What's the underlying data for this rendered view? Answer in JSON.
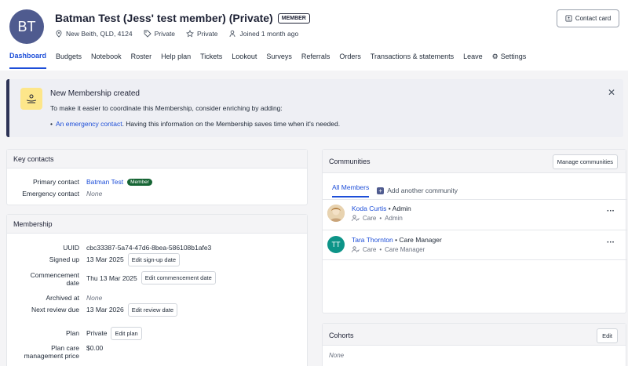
{
  "header": {
    "initials": "BT",
    "title": "Batman Test (Jess' test member) (Private)",
    "badge": "MEMBER",
    "location": "New Beith, QLD, 4124",
    "privacy1": "Private",
    "privacy2": "Private",
    "joined": "Joined 1 month ago",
    "contact_card": "Contact card"
  },
  "tabs": [
    {
      "label": "Dashboard"
    },
    {
      "label": "Budgets"
    },
    {
      "label": "Notebook"
    },
    {
      "label": "Roster"
    },
    {
      "label": "Help plan"
    },
    {
      "label": "Tickets"
    },
    {
      "label": "Lookout"
    },
    {
      "label": "Surveys"
    },
    {
      "label": "Referrals"
    },
    {
      "label": "Orders"
    },
    {
      "label": "Transactions & statements"
    },
    {
      "label": "Leave"
    },
    {
      "label": "Settings"
    }
  ],
  "alert": {
    "title": "New Membership created",
    "body": "To make it easier to coordinate this Membership, consider enriching by adding:",
    "bullet_link": "An emergency contact",
    "bullet_text": ". Having this information on the Membership saves time when it's needed."
  },
  "key_contacts": {
    "title": "Key contacts",
    "primary_label": "Primary contact",
    "primary_value": "Batman Test",
    "primary_badge": "Member",
    "emergency_label": "Emergency contact",
    "emergency_value": "None"
  },
  "membership": {
    "title": "Membership",
    "uuid_label": "UUID",
    "uuid_value": "cbc33387-5a74-47d6-8bea-586108b1afe3",
    "signed_label": "Signed up",
    "signed_value": "13 Mar 2025",
    "signed_btn": "Edit sign-up date",
    "commence_label_1": "Commencement",
    "commence_label_2": "date",
    "commence_value": "Thu 13 Mar 2025",
    "commence_btn": "Edit commencement date",
    "archived_label": "Archived at",
    "archived_value": "None",
    "review_label": "Next review due",
    "review_value": "13 Mar 2026",
    "review_btn": "Edit review date",
    "plan_label": "Plan",
    "plan_value": "Private",
    "plan_btn": "Edit plan",
    "price_label_1": "Plan care",
    "price_label_2": "management price",
    "price_value": "$0.00"
  },
  "communities": {
    "title": "Communities",
    "manage_btn": "Manage communities",
    "tab_all": "All Members",
    "tab_add": "Add another community",
    "members": [
      {
        "name": "Koda Curtis",
        "role": "Admin",
        "group": "Care",
        "sub_role": "Admin",
        "initials": ""
      },
      {
        "name": "Tara Thornton",
        "role": "Care Manager",
        "group": "Care",
        "sub_role": "Care Manager",
        "initials": "TT"
      }
    ]
  },
  "cohorts": {
    "title": "Cohorts",
    "edit_btn": "Edit",
    "value": "None"
  },
  "colors": {
    "accent": "#1d4ed8",
    "avatar": "#4f5b8f",
    "tt_avatar": "#0d9488",
    "member_pill": "#166534"
  }
}
